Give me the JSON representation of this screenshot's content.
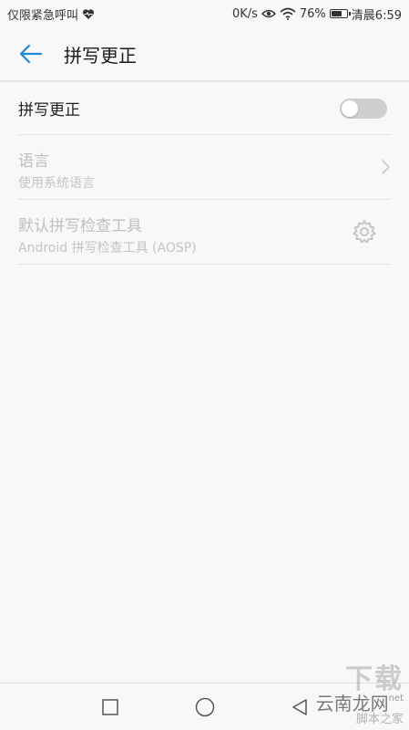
{
  "status_bar": {
    "carrier_text": "仅限紧急呼叫",
    "heart_icon": "heart-rate-icon",
    "network_speed": "0K/s",
    "eye_icon": "eye-icon",
    "wifi_icon": "wifi-icon",
    "battery_percent": "76%",
    "battery_level": 0.76,
    "time": "清晨6:59"
  },
  "app_bar": {
    "back_icon": "arrow-left-icon",
    "title": "拼写更正",
    "accent_color": "#1e88d8"
  },
  "settings": {
    "spell_check": {
      "label": "拼写更正",
      "enabled": false
    },
    "language": {
      "title": "语言",
      "subtitle": "使用系统语言"
    },
    "default_checker": {
      "title": "默认拼写检查工具",
      "subtitle": "Android 拼写检查工具 (AOSP)"
    }
  },
  "nav_bar": {
    "recents_icon": "square-icon",
    "home_icon": "circle-icon",
    "back_icon": "triangle-icon"
  },
  "watermark": {
    "top": "下载",
    "middle": "云南龙网",
    "net": "net",
    "bottom": "脚本之家"
  }
}
